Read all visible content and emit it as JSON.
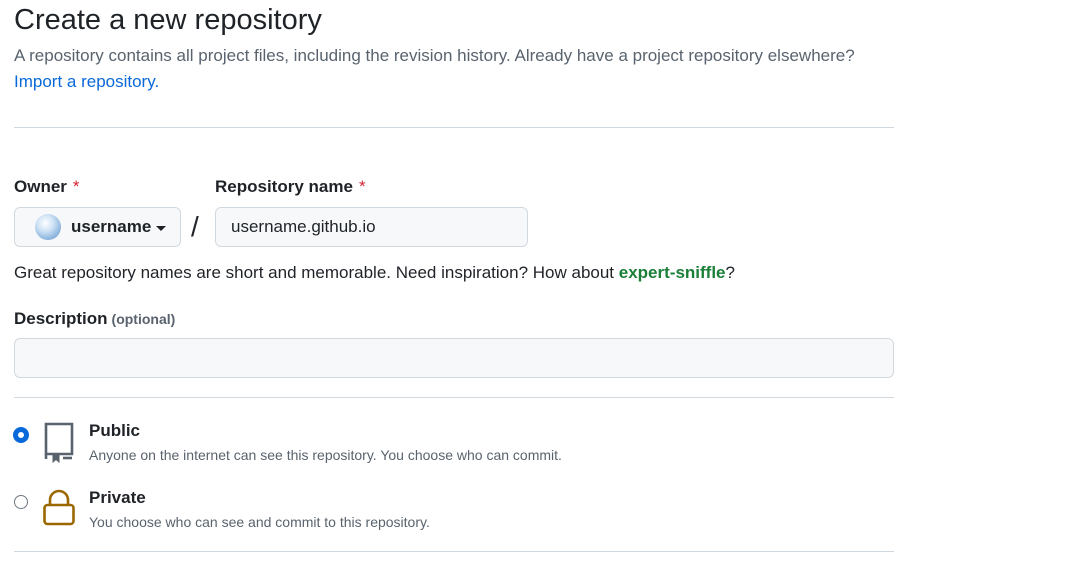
{
  "page": {
    "title": "Create a new repository",
    "subtitle": "A repository contains all project files, including the revision history. Already have a project repository elsewhere?",
    "import_link": "Import a repository."
  },
  "form": {
    "owner_label": "Owner",
    "required_mark": "*",
    "owner_value": "username",
    "separator": "/",
    "repo_label": "Repository name",
    "repo_value": "username.github.io",
    "hint_prefix": "Great repository names are short and memorable. Need inspiration? How about ",
    "hint_suggestion": "expert-sniffle",
    "hint_suffix": "?",
    "description_label": "Description",
    "description_optional": "(optional)",
    "description_value": ""
  },
  "visibility": {
    "options": [
      {
        "title": "Public",
        "description": "Anyone on the internet can see this repository. You choose who can commit.",
        "selected": true,
        "icon": "repo-icon"
      },
      {
        "title": "Private",
        "description": "You choose who can see and commit to this repository.",
        "selected": false,
        "icon": "lock-icon"
      }
    ]
  },
  "colors": {
    "link": "#0969da",
    "suggestion": "#1a7f37",
    "required": "#d1242f",
    "lock": "#9a6700"
  }
}
